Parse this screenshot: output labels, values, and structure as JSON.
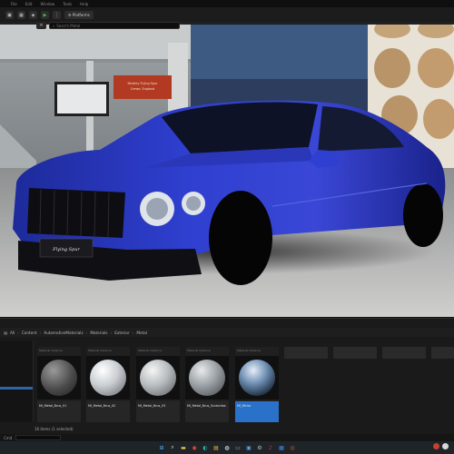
{
  "menubar": {
    "items": [
      "File",
      "Edit",
      "Window",
      "Tools",
      "Help"
    ]
  },
  "toolbar": {
    "platforms_label": "Platforms",
    "platforms_icon": "gear-icon"
  },
  "viewport": {
    "sign_lines": [
      "Bentley Flying Spur",
      "Crewe, England"
    ],
    "car_plate": "Flying Spur"
  },
  "content_browser": {
    "path": [
      "All",
      "Content",
      "AutomotiveMaterials",
      "Materials",
      "Exterior",
      "Metal"
    ],
    "search_placeholder": "Search Metal",
    "assets": [
      {
        "name": "MI_Metal_Brus_01",
        "type": "Material Instance",
        "sphere": "#5a5a5a",
        "selected": false
      },
      {
        "name": "MI_Metal_Brus_02",
        "type": "Material Instance",
        "sphere": "#c9cdd1",
        "selected": false
      },
      {
        "name": "MI_Metal_Brus_03",
        "type": "Material Instance",
        "sphere": "#b8bcbf",
        "selected": false
      },
      {
        "name": "MI_Metal_Brus_Scratches",
        "type": "Material Instance",
        "sphere": "#9aa0a5",
        "selected": false
      },
      {
        "name": "MI_Mirror",
        "type": "Material Instance",
        "sphere": "#6f8fb3",
        "selected": true
      }
    ],
    "status": "16 items (1 selected)",
    "cmd_label": "Cmd",
    "accent": "#2a72c9"
  },
  "taskbar": {
    "icons": [
      "windows-start-icon",
      "search-icon",
      "file-explorer-icon",
      "chrome-icon",
      "edge-icon",
      "folder-icon",
      "unreal-icon",
      "terminal-icon",
      "photos-icon",
      "settings-icon",
      "music-icon",
      "store-icon",
      "capture-icon",
      "mail-icon",
      "epic-icon"
    ]
  }
}
